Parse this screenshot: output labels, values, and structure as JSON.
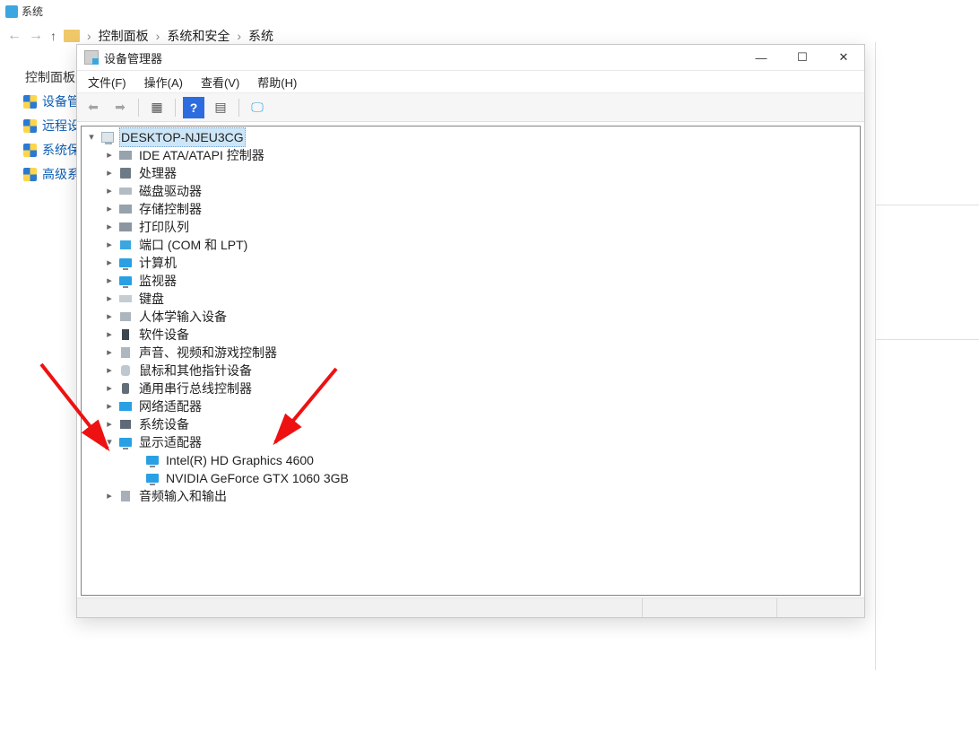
{
  "bg": {
    "title": "系统",
    "crumbs": [
      "控制面板",
      "系统和安全",
      "系统"
    ],
    "sidebar": {
      "home": "控制面板",
      "items": [
        "设备管理",
        "远程设置",
        "系统保护",
        "高级系统"
      ]
    }
  },
  "dm": {
    "title": "设备管理器",
    "menus": [
      "文件(F)",
      "操作(A)",
      "查看(V)",
      "帮助(H)"
    ],
    "root": "DESKTOP-NJEU3CG",
    "categories": [
      {
        "label": "IDE ATA/ATAPI 控制器",
        "icon": "ic-drive",
        "expanded": false
      },
      {
        "label": "处理器",
        "icon": "ic-chip",
        "expanded": false
      },
      {
        "label": "磁盘驱动器",
        "icon": "ic-disk",
        "expanded": false
      },
      {
        "label": "存储控制器",
        "icon": "ic-drive",
        "expanded": false
      },
      {
        "label": "打印队列",
        "icon": "ic-printer",
        "expanded": false
      },
      {
        "label": "端口 (COM 和 LPT)",
        "icon": "ic-port",
        "expanded": false
      },
      {
        "label": "计算机",
        "icon": "ic-monitor",
        "expanded": false
      },
      {
        "label": "监视器",
        "icon": "ic-monitor",
        "expanded": false
      },
      {
        "label": "键盘",
        "icon": "ic-kbd",
        "expanded": false
      },
      {
        "label": "人体学输入设备",
        "icon": "ic-hid",
        "expanded": false
      },
      {
        "label": "软件设备",
        "icon": "ic-sw",
        "expanded": false
      },
      {
        "label": "声音、视频和游戏控制器",
        "icon": "ic-sound",
        "expanded": false
      },
      {
        "label": "鼠标和其他指针设备",
        "icon": "ic-mouse",
        "expanded": false
      },
      {
        "label": "通用串行总线控制器",
        "icon": "ic-usb",
        "expanded": false
      },
      {
        "label": "网络适配器",
        "icon": "ic-net",
        "expanded": false
      },
      {
        "label": "系统设备",
        "icon": "ic-sys",
        "expanded": false
      },
      {
        "label": "显示适配器",
        "icon": "ic-monitor",
        "expanded": true,
        "children": [
          {
            "label": "Intel(R) HD Graphics 4600",
            "icon": "ic-monitor"
          },
          {
            "label": "NVIDIA GeForce GTX 1060 3GB",
            "icon": "ic-monitor"
          }
        ]
      },
      {
        "label": "音频输入和输出",
        "icon": "ic-audio",
        "expanded": false
      }
    ]
  }
}
